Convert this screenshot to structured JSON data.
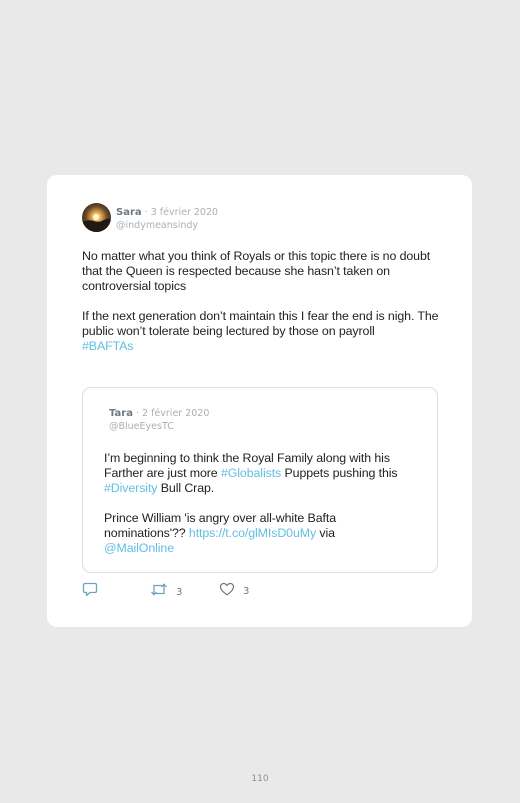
{
  "tweet": {
    "author_name": "Sara",
    "date": " · 3 février 2020",
    "handle": "@indymeansindy",
    "text_1": "No matter what you think of Royals or this topic there is no doubt that the Queen is respected because she hasn’t taken on controversial topics",
    "text_2": "If the next generation don’t maintain this I fear the end is nigh. The public won’t tolerate being lectured by those on payroll",
    "hashtag": "#BAFTAs"
  },
  "quoted_tweet": {
    "author_name": "Tara",
    "date": " · 2 février 2020",
    "handle": "@BlueEyesTC",
    "line1_a": "I’m beginning to think the Royal Family along with his Farther are just more ",
    "hashtag1": "#Globalists",
    "line1_b": " Puppets pushing this ",
    "hashtag2": "#Diversity",
    "line1_c": " Bull Crap.",
    "line2_a": "Prince William 'is angry over all-white Bafta nominations'?? ",
    "url": "https://t.co/glMIsD0uMy",
    "line2_b": " via",
    "mention": "@MailOnline"
  },
  "actions": {
    "reply_icon": "reply-icon",
    "retweet_icon": "retweet-icon",
    "like_icon": "heart-icon",
    "retweet_count": "3",
    "like_count": "3"
  },
  "colors": {
    "link": "#60bfe3",
    "background": "#e9e9ea"
  },
  "page_number": "110"
}
